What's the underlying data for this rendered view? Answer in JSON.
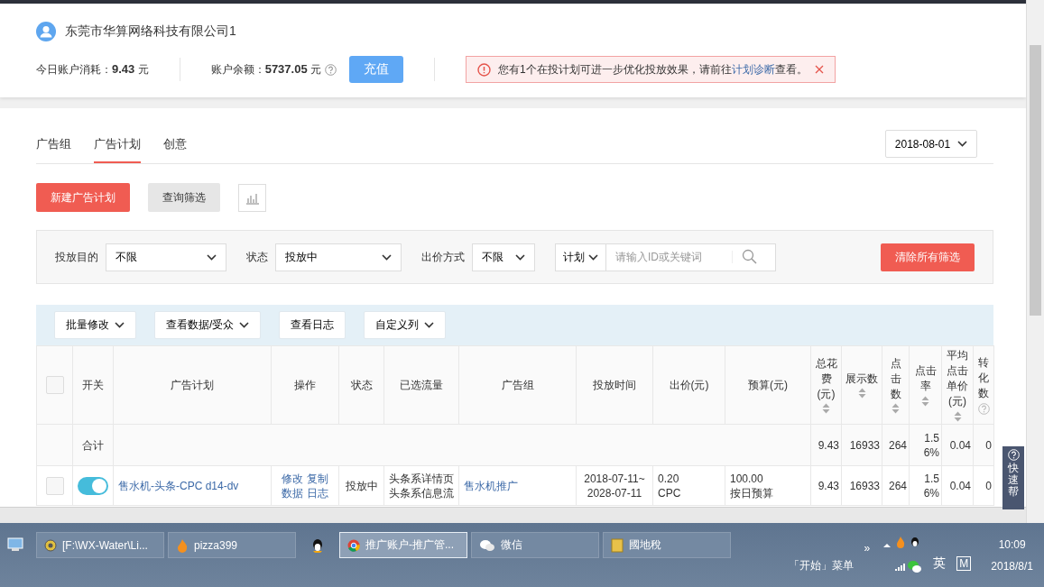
{
  "account": {
    "name": "东莞市华算网络科技有限公司1",
    "today_spend": "今日账户消耗：**9.43** 元",
    "balance": "账户余额：**5737.05** 元",
    "recharge": "充值",
    "alert": {
      "text": "您有1个在投计划可进一步优化投放效果，请前往",
      "link": "计划诊断",
      "tail": "查看。"
    }
  },
  "tabs": [
    {
      "label": "广告组",
      "selected": false
    },
    {
      "label": "广告计划",
      "selected": true
    },
    {
      "label": "创意",
      "selected": false
    }
  ],
  "date": "2018-08-01",
  "actions": {
    "create": "新建广告计划",
    "query": "查询筛选"
  },
  "filters": [
    {
      "label": "投放目的",
      "value": "不限"
    },
    {
      "label": "状态",
      "value": "投放中"
    },
    {
      "label": "出价方式",
      "value": "不限"
    }
  ],
  "search": {
    "scope": "计划",
    "placeholder": "请输入ID或关键词"
  },
  "clear_filters": "清除所有筛选",
  "toolbar": [
    {
      "label": "批量修改",
      "dropdown": true
    },
    {
      "label": "查看数据/受众",
      "dropdown": true
    },
    {
      "label": "查看日志",
      "dropdown": false
    },
    {
      "label": "自定义列",
      "dropdown": true
    }
  ],
  "table": {
    "header_checked": false,
    "columns": [
      {
        "label": "开关",
        "sortable": false,
        "help": false
      },
      {
        "label": "广告计划",
        "sortable": false,
        "help": false
      },
      {
        "label": "操作",
        "sortable": false,
        "help": false
      },
      {
        "label": "状态",
        "sortable": false,
        "help": false
      },
      {
        "label": "已选流量",
        "sortable": false,
        "help": false
      },
      {
        "label": "广告组",
        "sortable": false,
        "help": false
      },
      {
        "label": "投放时间",
        "sortable": false,
        "help": false
      },
      {
        "label": "出价(元)",
        "sortable": false,
        "help": false
      },
      {
        "label": "预算(元)",
        "sortable": false,
        "help": false
      },
      {
        "label": "总花费(元)",
        "sortable": true,
        "help": false
      },
      {
        "label": "展示数",
        "sortable": true,
        "help": false
      },
      {
        "label": "点击数",
        "sortable": true,
        "help": false
      },
      {
        "label": "点击率",
        "sortable": true,
        "help": false
      },
      {
        "label": "平均点击单价(元)",
        "sortable": true,
        "help": false
      },
      {
        "label": "转化数",
        "sortable": false,
        "help": true
      }
    ],
    "total": {
      "label": "合计",
      "values": [
        "9.43",
        "16933",
        "264",
        "1.56%",
        "0.04",
        "0"
      ]
    },
    "rows": [
      {
        "checked": false,
        "on": true,
        "plan": "售水机-头条-CPC d14-dv",
        "ops": [
          "修改",
          "复制",
          "数据",
          "日志"
        ],
        "status": "投放中",
        "traffic": [
          "头条系详情页",
          "头条系信息流"
        ],
        "group": "售水机推广",
        "time": [
          "2018-07-11~",
          "2028-07-11"
        ],
        "bid": [
          "0.20",
          "CPC"
        ],
        "budget": [
          "100.00",
          "按日预算"
        ],
        "values": [
          "9.43",
          "16933",
          "264",
          "1.56%",
          "0.04",
          "0"
        ]
      }
    ]
  },
  "help_panel": "快速帮",
  "taskbar": {
    "items": [
      {
        "kind": "explorer",
        "label": "[F:\\WX-Water\\Li...",
        "selected": false
      },
      {
        "kind": "flame",
        "label": "pizza399",
        "selected": false
      },
      {
        "kind": "penguin",
        "selected": false
      },
      {
        "kind": "browser",
        "label": "推广账户-推广管...",
        "selected": true
      },
      {
        "kind": "chat",
        "label": "微信",
        "selected": false
      },
      {
        "kind": "folder",
        "label": "國地稅",
        "selected": false
      }
    ],
    "start_menu": "「开始」菜单",
    "expand": "»",
    "ime": "英",
    "ime_mode": "M",
    "time": "10:09",
    "date": "2018/8/1"
  }
}
